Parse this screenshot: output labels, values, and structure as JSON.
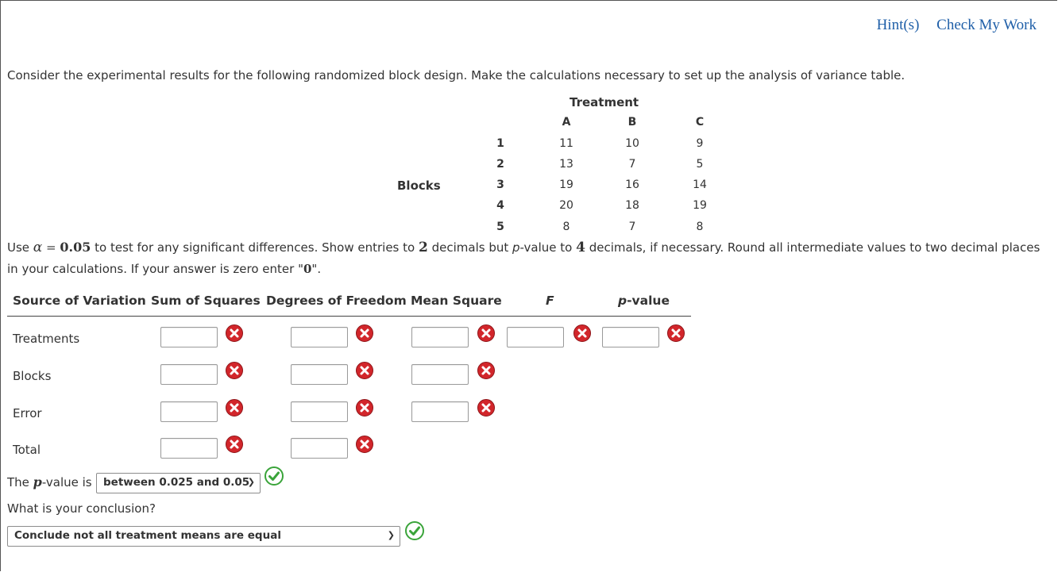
{
  "header": {
    "hints_label": "Hint(s)",
    "check_label": "Check My Work"
  },
  "intro": "Consider the experimental results for the following randomized block design. Make the calculations necessary to set up the analysis of variance table.",
  "data_table": {
    "treatment_label": "Treatment",
    "blocks_label": "Blocks",
    "columns": [
      "A",
      "B",
      "C"
    ],
    "rows": [
      {
        "block": "1",
        "values": [
          "11",
          "10",
          "9"
        ]
      },
      {
        "block": "2",
        "values": [
          "13",
          "7",
          "5"
        ]
      },
      {
        "block": "3",
        "values": [
          "19",
          "16",
          "14"
        ]
      },
      {
        "block": "4",
        "values": [
          "20",
          "18",
          "19"
        ]
      },
      {
        "block": "5",
        "values": [
          "8",
          "7",
          "8"
        ]
      }
    ]
  },
  "instructions": {
    "use": "Use ",
    "alpha": "α",
    "eq": " = ",
    "alpha_value": "0.05",
    "p1": " to test for any significant differences. Show entries to ",
    "decimals": "2",
    "p2": " decimals but ",
    "p": "p",
    "p3": "-value to ",
    "pdecimals": "4",
    "p4": " decimals, if necessary. Round all intermediate values to two decimal places",
    "line2a": "in your calculations. If your answer is zero enter \"",
    "zero": "0",
    "line2b": "\"."
  },
  "anova": {
    "headers": {
      "source": "Source of Variation",
      "ss": "Sum of Squares",
      "df": "Degrees of Freedom",
      "ms": "Mean Square",
      "f": "F",
      "p": "p",
      "pvalue_suffix": "-value"
    },
    "rows": [
      {
        "label": "Treatments",
        "ss": "",
        "df": "",
        "ms": "",
        "f": "",
        "p": ""
      },
      {
        "label": "Blocks",
        "ss": "",
        "df": "",
        "ms": ""
      },
      {
        "label": "Error",
        "ss": "",
        "df": "",
        "ms": ""
      },
      {
        "label": "Total",
        "ss": "",
        "df": ""
      }
    ]
  },
  "pvalue_question": {
    "prefix": "The ",
    "p": "p",
    "suffix": "-value is",
    "selected": "between 0.025 and 0.05"
  },
  "conclusion": {
    "question": "What is your conclusion?",
    "selected": "Conclude not all treatment means are equal"
  },
  "colors": {
    "link": "#1f5fa8",
    "incorrect": "#d2262b",
    "correct": "#3aa43a"
  }
}
